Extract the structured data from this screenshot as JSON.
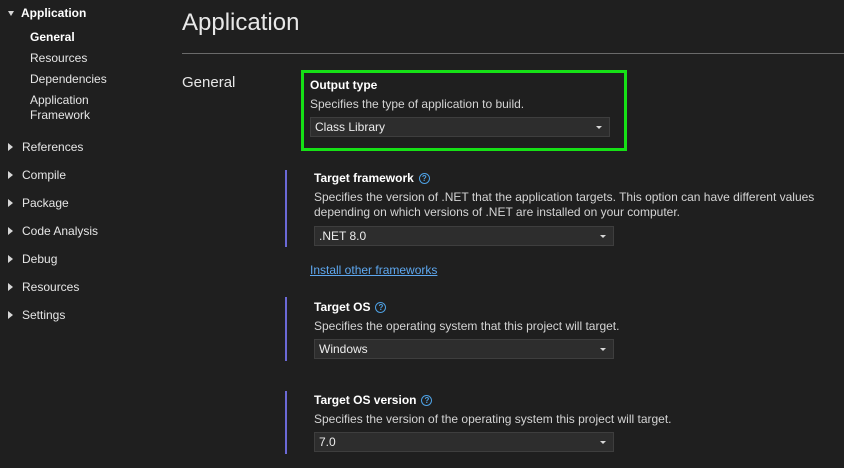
{
  "sidebar": {
    "application": {
      "label": "Application",
      "children": [
        "General",
        "Resources",
        "Dependencies",
        "Application Framework"
      ]
    },
    "items": [
      "References",
      "Compile",
      "Package",
      "Code Analysis",
      "Debug",
      "Resources",
      "Settings"
    ]
  },
  "page": {
    "title": "Application",
    "section": "General"
  },
  "settings": {
    "output_type": {
      "title": "Output type",
      "description": "Specifies the type of application to build.",
      "value": "Class Library"
    },
    "target_framework": {
      "title": "Target framework",
      "description": "Specifies the version of .NET that the application targets. This option can have different values depending on which versions of .NET are installed on your computer.",
      "value": ".NET 8.0",
      "link": "Install other frameworks"
    },
    "target_os": {
      "title": "Target OS",
      "description": "Specifies the operating system that this project will target.",
      "value": "Windows"
    },
    "target_os_version": {
      "title": "Target OS version",
      "description": "Specifies the version of the operating system this project will target.",
      "value": "7.0"
    }
  },
  "icons": {
    "help": "?"
  },
  "colors": {
    "highlight": "#16e016",
    "accent": "#6b69d6",
    "link": "#5ea8f0"
  }
}
